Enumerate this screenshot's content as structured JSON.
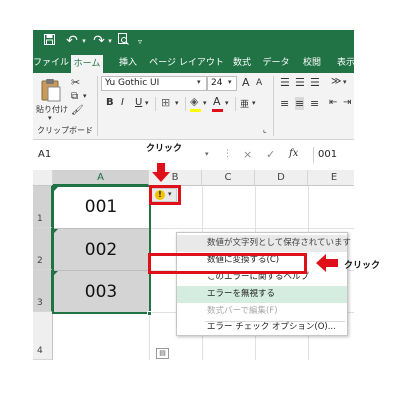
{
  "quick_access": {
    "save_icon": "save-icon",
    "undo_icon": "undo-icon",
    "redo_icon": "redo-icon",
    "preview_icon": "print-preview-icon",
    "customize_icon": "customize-qat-icon"
  },
  "tabs": [
    "ファイル",
    "ホーム",
    "挿入",
    "ページ レイアウト",
    "数式",
    "データ",
    "校閲",
    "表示"
  ],
  "active_tab": "ホーム",
  "ribbon": {
    "paste_label": "貼り付け",
    "clipboard_group": "クリップボード",
    "font_name": "Yu Gothic UI",
    "font_size": "24",
    "grow_font": "A",
    "shrink_font": "A",
    "bold": "B",
    "italic": "I",
    "underline": "U",
    "font_color_letter": "A",
    "phonetic_letter": "亜",
    "launcher": "⌞"
  },
  "formula_bar": {
    "name_box": "A1",
    "cancel_symbol": "×",
    "enter_symbol": "✓",
    "fx_label": "fx",
    "formula_value": "001"
  },
  "sheet": {
    "columns": [
      "A",
      "B",
      "C",
      "D",
      "E"
    ],
    "rows": [
      "1",
      "2",
      "3",
      "4"
    ],
    "cells": [
      "001",
      "002",
      "003"
    ],
    "error_button_symbol": "!"
  },
  "error_menu": {
    "items": [
      "数値が文字列として保存されています",
      "数値に変換する(C)",
      "このエラーに関するヘルプ",
      "エラーを無視する",
      "数式バーで編集(F)",
      "エラー チェック オプション(O)..."
    ]
  },
  "annotations": {
    "click_top": "クリック",
    "click_right": "クリック",
    "highlight_color": "#e0101b",
    "excel_green": "#217346"
  }
}
